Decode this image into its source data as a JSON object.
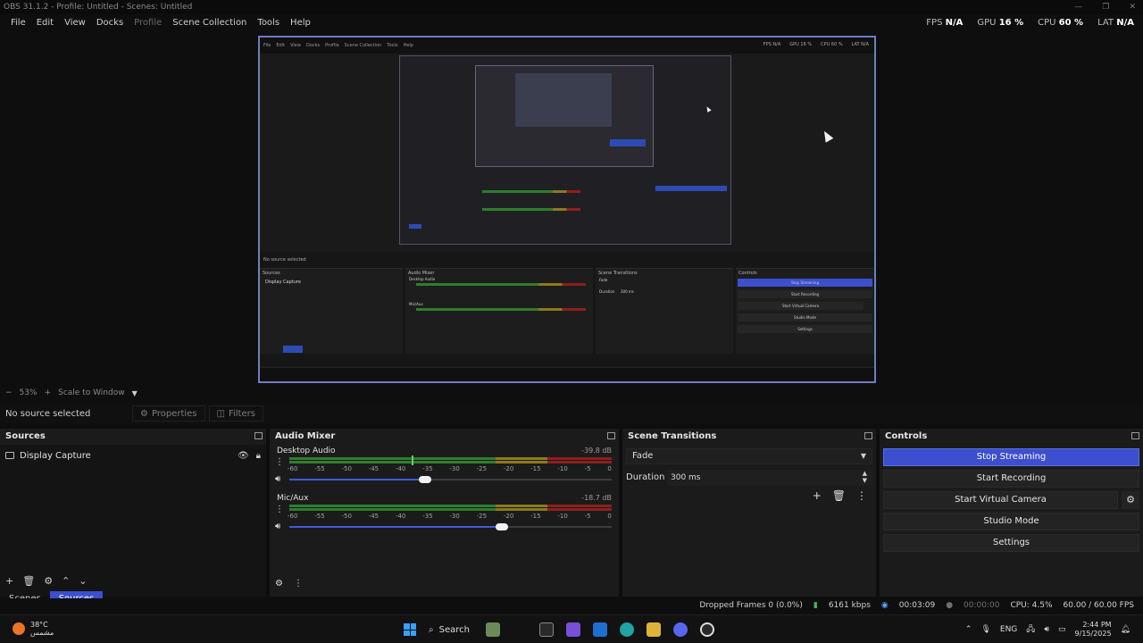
{
  "window": {
    "title": "OBS 31.1.2 - Profile: Untitled - Scenes: Untitled",
    "controls": [
      "—",
      "❐",
      "✕"
    ]
  },
  "menu": {
    "items": [
      "File",
      "Edit",
      "View",
      "Docks",
      "Profile",
      "Scene Collection",
      "Tools",
      "Help"
    ]
  },
  "stats": {
    "fps_label": "FPS",
    "fps": "N/A",
    "gpu_label": "GPU",
    "gpu": "16 %",
    "cpu_label": "CPU",
    "cpu": "60 %",
    "lat_label": "LAT",
    "lat": "N/A"
  },
  "preview": {
    "border_color": "#6f7fbf",
    "nested_menu": [
      "File",
      "Edit",
      "View",
      "Docks",
      "Profile",
      "Scene Collection",
      "Tools",
      "Help"
    ],
    "nested_stats": [
      "FPS N/A",
      "GPU 16 %",
      "CPU 60 %",
      "LAT N/A"
    ],
    "nested_source": "Display Capture",
    "nested_no_source": "No source selected",
    "nested_panels": [
      "Sources",
      "Audio Mixer",
      "Scene Transitions",
      "Controls"
    ],
    "nested_controls": [
      "Stop Streaming",
      "Start Recording",
      "Start Virtual Camera",
      "Studio Mode",
      "Settings"
    ],
    "nested_channels": [
      "Desktop Audio",
      "Mic/Aux"
    ],
    "nested_fade": "Fade",
    "nested_duration": "Duration",
    "nested_duration_value": "300 ms"
  },
  "zoom": {
    "zoom_level": "53%",
    "mode": "Scale to Window"
  },
  "context": {
    "no_source": "No source selected",
    "properties": "Properties",
    "filters": "Filters"
  },
  "sources": {
    "title": "Sources",
    "items": [
      {
        "name": "Display Capture"
      }
    ]
  },
  "tabs": {
    "scenes": "Scenes",
    "sources": "Sources"
  },
  "mixer": {
    "title": "Audio Mixer",
    "channels": [
      {
        "name": "Desktop Audio",
        "db": "-39.8 dB",
        "volume": 0.42
      },
      {
        "name": "Mic/Aux",
        "db": "-18.7 dB",
        "volume": 0.66
      }
    ],
    "ticks": [
      "-60",
      "-55",
      "-50",
      "-45",
      "-40",
      "-35",
      "-30",
      "-25",
      "-20",
      "-15",
      "-10",
      "-5",
      "0"
    ]
  },
  "transitions": {
    "title": "Scene Transitions",
    "selected": "Fade",
    "duration_label": "Duration",
    "duration_value": "300 ms"
  },
  "controls": {
    "title": "Controls",
    "buttons": [
      "Stop Streaming",
      "Start Recording",
      "Start Virtual Camera",
      "Studio Mode",
      "Settings"
    ],
    "accent": "#3b4fcf"
  },
  "status": {
    "dropped": "Dropped Frames 0 (0.0%)",
    "bitrate": "6161 kbps",
    "stream_time": "00:03:09",
    "rec_time": "00:00:00",
    "cpu": "CPU: 4.5%",
    "fps": "60.00 / 60.00 FPS"
  },
  "taskbar": {
    "temp": "38°C",
    "weather_desc": "مشمس",
    "search": "Search",
    "lang": "ENG",
    "time": "2:44 PM",
    "date": "9/15/2025"
  }
}
